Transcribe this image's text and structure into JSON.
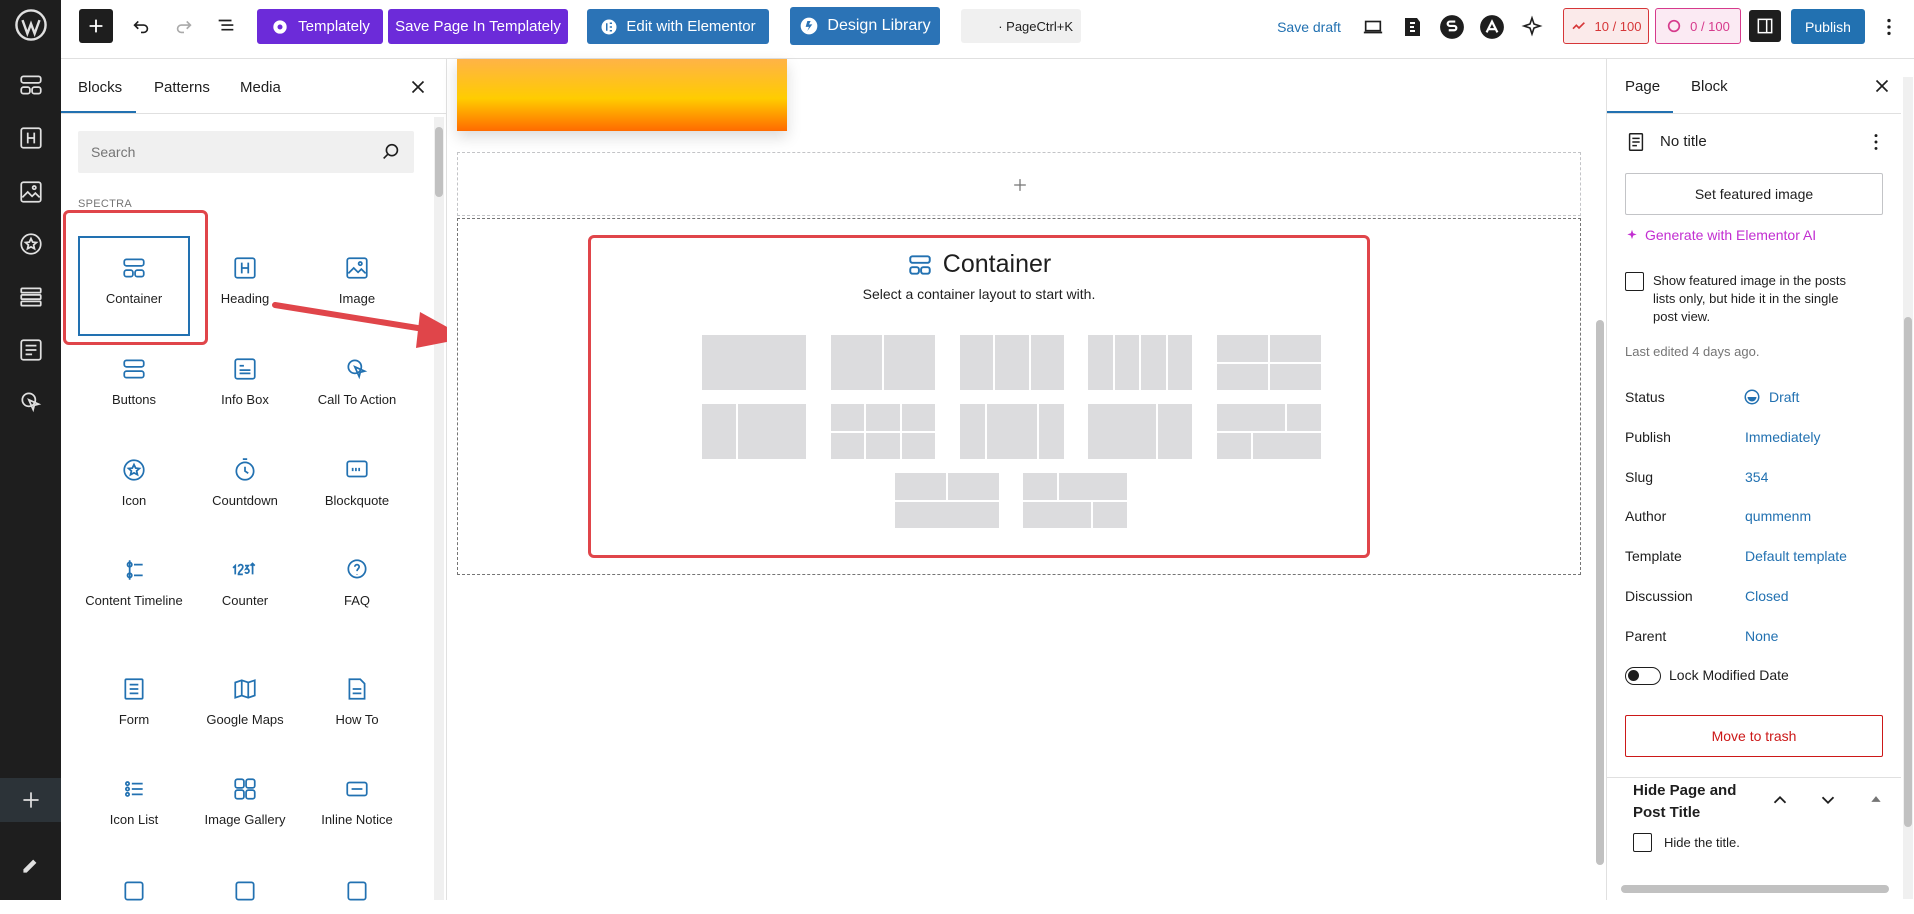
{
  "toolbar": {
    "templately": "Templately",
    "save_templately": "Save Page In Templately",
    "edit_elementor": "Edit with Elementor",
    "design_library": "Design Library",
    "command": "· PageCtrl+K",
    "save_draft": "Save draft",
    "score1": "10 / 100",
    "score2": "0 / 100",
    "publish": "Publish"
  },
  "inserter": {
    "tabs": [
      "Blocks",
      "Patterns",
      "Media"
    ],
    "search_placeholder": "Search",
    "category": "SPECTRA",
    "blocks": [
      {
        "label": "Container",
        "icon": "container-icon"
      },
      {
        "label": "Heading",
        "icon": "heading-icon"
      },
      {
        "label": "Image",
        "icon": "image-icon"
      },
      {
        "label": "Buttons",
        "icon": "buttons-icon"
      },
      {
        "label": "Info Box",
        "icon": "info-box-icon"
      },
      {
        "label": "Call To Action",
        "icon": "call-to-action-icon"
      },
      {
        "label": "Icon",
        "icon": "icon-block-icon"
      },
      {
        "label": "Countdown",
        "icon": "countdown-icon"
      },
      {
        "label": "Blockquote",
        "icon": "blockquote-icon"
      },
      {
        "label": "Content Timeline",
        "icon": "content-timeline-icon"
      },
      {
        "label": "Counter",
        "icon": "counter-icon"
      },
      {
        "label": "FAQ",
        "icon": "faq-icon"
      },
      {
        "label": "Form",
        "icon": "form-icon"
      },
      {
        "label": "Google Maps",
        "icon": "google-maps-icon"
      },
      {
        "label": "How To",
        "icon": "how-to-icon"
      },
      {
        "label": "Icon List",
        "icon": "icon-list-icon"
      },
      {
        "label": "Image Gallery",
        "icon": "image-gallery-icon"
      },
      {
        "label": "Inline Notice",
        "icon": "inline-notice-icon"
      }
    ]
  },
  "container": {
    "title": "Container",
    "subtitle": "Select a container layout to start with."
  },
  "sidebar": {
    "tabs": [
      "Page",
      "Block"
    ],
    "title": "No title",
    "set_featured": "Set featured image",
    "generate_ai": "Generate with Elementor AI",
    "featured_note": "Show featured image in the posts lists only, but hide it in the single post view.",
    "last_edited": "Last edited 4 days ago.",
    "rows": [
      {
        "label": "Status",
        "value": "Draft"
      },
      {
        "label": "Publish",
        "value": "Immediately"
      },
      {
        "label": "Slug",
        "value": "354"
      },
      {
        "label": "Author",
        "value": "qummenm"
      },
      {
        "label": "Template",
        "value": "Default template"
      },
      {
        "label": "Discussion",
        "value": "Closed"
      },
      {
        "label": "Parent",
        "value": "None"
      }
    ],
    "lock_modified": "Lock Modified Date",
    "move_trash": "Move to trash",
    "hide_title_heading": "Hide Page and Post Title",
    "hide_title": "Hide the title."
  },
  "colors": {
    "accent": "#2271b1",
    "purple": "#6c2bd9",
    "red": "#e0454a"
  }
}
